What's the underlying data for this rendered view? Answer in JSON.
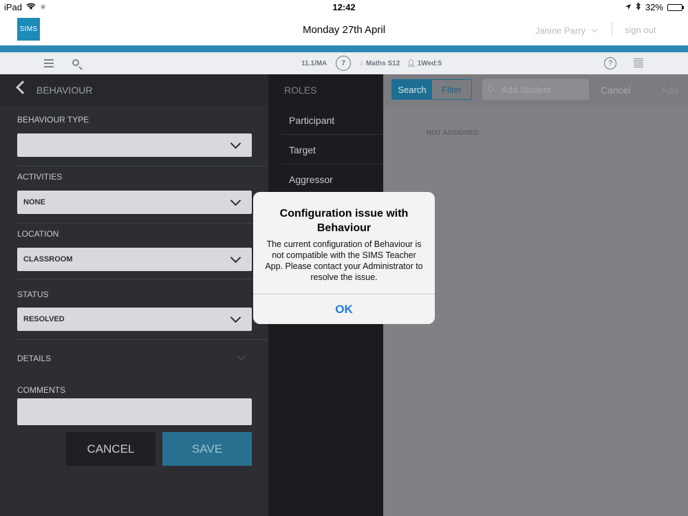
{
  "status_bar": {
    "device": "iPad",
    "time": "12:42",
    "battery": "32%"
  },
  "app_header": {
    "logo": "SIMS",
    "date": "Monday 27th April",
    "user": "Janine Parry",
    "sign_out": "sign out"
  },
  "toolbar": {
    "class_code": "11.1/MA",
    "register_count": "7",
    "subject": "Maths S12",
    "period": "1Wed:5"
  },
  "left_panel": {
    "title": "BEHAVIOUR",
    "fields": {
      "behaviour_type": {
        "label": "BEHAVIOUR TYPE",
        "value": ""
      },
      "activities": {
        "label": "ACTIVITIES",
        "value": "NONE"
      },
      "location": {
        "label": "LOCATION",
        "value": "CLASSROOM"
      },
      "status": {
        "label": "STATUS",
        "value": "RESOLVED"
      },
      "details": {
        "label": "DETAILS"
      },
      "comments": {
        "label": "COMMENTS"
      }
    },
    "cancel_label": "CANCEL",
    "save_label": "SAVE"
  },
  "roles_panel": {
    "title": "ROLES",
    "items": [
      "Participant",
      "Target",
      "Aggressor"
    ]
  },
  "right_panel": {
    "search_label": "Search",
    "filter_label": "Filter",
    "add_student_placeholder": "Add Student",
    "cancel_label": "Cancel",
    "add_label": "Add",
    "not_assigned": "NOT ASSIGNED"
  },
  "alert": {
    "title": "Configuration issue with Behaviour",
    "message": "The current configuration of Behaviour is not compatible with the SIMS Teacher App. Please contact your Administrator to resolve the issue.",
    "ok_label": "OK"
  },
  "colors": {
    "accent": "#2a89b5",
    "alert_button": "#1a7ae6"
  }
}
